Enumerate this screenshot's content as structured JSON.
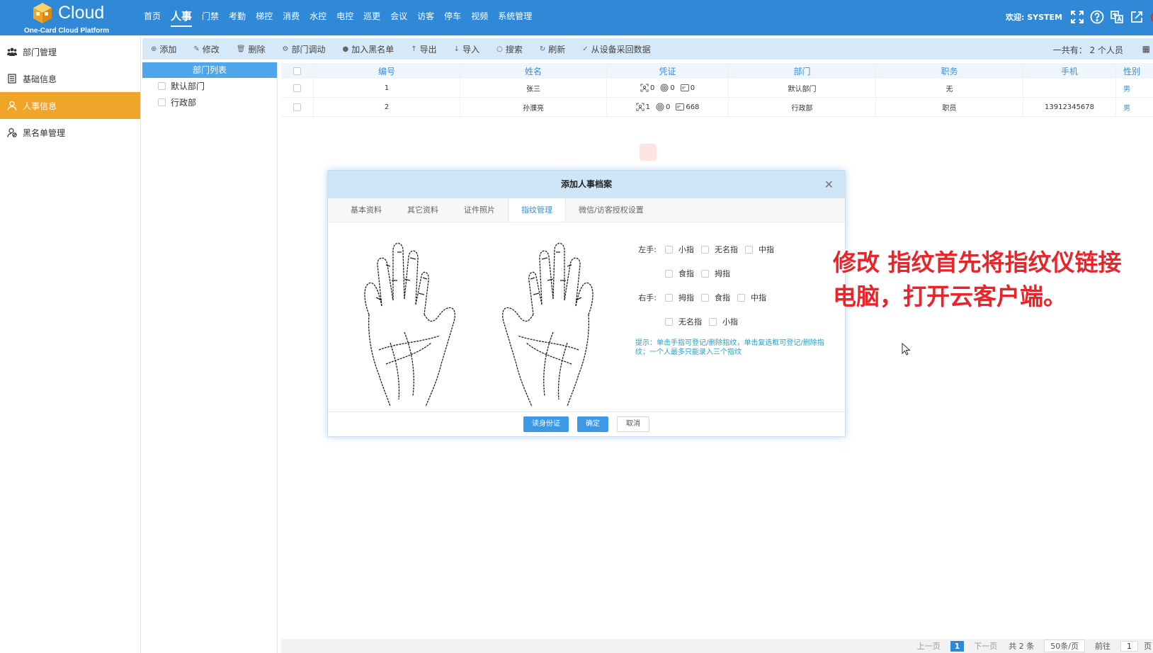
{
  "app": {
    "logo_title": "Cloud",
    "logo_subtitle": "One-Card Cloud Platform",
    "welcome": "欢迎: SYSTEM"
  },
  "nav": [
    {
      "label": "首页",
      "active": false
    },
    {
      "label": "人事",
      "active": true
    },
    {
      "label": "门禁",
      "active": false
    },
    {
      "label": "考勤",
      "active": false
    },
    {
      "label": "梯控",
      "active": false
    },
    {
      "label": "消费",
      "active": false
    },
    {
      "label": "水控",
      "active": false
    },
    {
      "label": "电控",
      "active": false
    },
    {
      "label": "巡更",
      "active": false
    },
    {
      "label": "会议",
      "active": false
    },
    {
      "label": "访客",
      "active": false
    },
    {
      "label": "停车",
      "active": false
    },
    {
      "label": "视频",
      "active": false
    },
    {
      "label": "系统管理",
      "active": false
    }
  ],
  "top_icons": [
    "fullscreen-icon",
    "help-icon",
    "translate-icon",
    "edit-external-icon",
    "power-icon"
  ],
  "sidebar": [
    {
      "label": "部门管理",
      "icon": "group-icon",
      "active": false
    },
    {
      "label": "基础信息",
      "icon": "document-icon",
      "active": false
    },
    {
      "label": "人事信息",
      "icon": "user-icon",
      "active": true
    },
    {
      "label": "黑名单管理",
      "icon": "user-block-icon",
      "active": false
    }
  ],
  "toolbar": {
    "buttons": [
      {
        "label": "添加",
        "glyph": "⊕"
      },
      {
        "label": "修改",
        "glyph": "✎"
      },
      {
        "label": "删除",
        "glyph": "🗑"
      },
      {
        "label": "部门调动",
        "glyph": "⚙"
      },
      {
        "label": "加入黑名单",
        "glyph": "●"
      },
      {
        "label": "导出",
        "glyph": "↑"
      },
      {
        "label": "导入",
        "glyph": "↓"
      },
      {
        "label": "搜索",
        "glyph": "○"
      },
      {
        "label": "刷新",
        "glyph": "↻"
      },
      {
        "label": "从设备采回数据",
        "glyph": "✓"
      }
    ],
    "total": "一共有： 2 个人员"
  },
  "dept": {
    "header": "部门列表",
    "items": [
      "默认部门",
      "行政部"
    ]
  },
  "table": {
    "headers": [
      "编号",
      "姓名",
      "凭证",
      "部门",
      "职务",
      "手机",
      "性别"
    ],
    "rows": [
      {
        "id": "1",
        "name": "张三",
        "face": "0",
        "finger": "0",
        "card": "0",
        "dept": "默认部门",
        "title": "无",
        "phone": "",
        "gender": "男"
      },
      {
        "id": "2",
        "name": "孙濮亮",
        "face": "1",
        "finger": "0",
        "card": "668",
        "dept": "行政部",
        "title": "职员",
        "phone": "13912345678",
        "gender": "男"
      }
    ]
  },
  "pager": {
    "prev": "上一页",
    "current": "1",
    "next": "下一页",
    "total": "共 2 条",
    "per_page": "50条/页",
    "goto": "前往",
    "goto_value": "1",
    "page_suffix": "页"
  },
  "modal": {
    "title": "添加人事档案",
    "tabs": [
      {
        "label": "基本资料",
        "active": false
      },
      {
        "label": "其它资料",
        "active": false
      },
      {
        "label": "证件照片",
        "active": false
      },
      {
        "label": "指纹管理",
        "active": true
      },
      {
        "label": "微信/访客授权设置",
        "active": false
      }
    ],
    "left_label": "左手:",
    "right_label": "右手:",
    "left_row1": [
      "小指",
      "无名指",
      "中指"
    ],
    "left_row2": [
      "食指",
      "拇指"
    ],
    "right_row1": [
      "拇指",
      "食指",
      "中指"
    ],
    "right_row2": [
      "无名指",
      "小指"
    ],
    "hint": "提示：单击手指可登记/删除指纹，单击复选框可登记/删除指纹；一个人最多只能录入三个指纹",
    "buttons": {
      "read_id": "读身份证",
      "ok": "确定",
      "cancel": "取消"
    }
  },
  "caption": {
    "line1": "修改 指纹首先将指纹仪链接",
    "line2": "电脑，打开云客户端。"
  },
  "colors": {
    "topbar": "#2f89d6",
    "sidebar_active": "#f0a52a",
    "toolbar_bg": "#d6e9f8",
    "accent": "#3d98e6",
    "caption": "#e8252b"
  }
}
